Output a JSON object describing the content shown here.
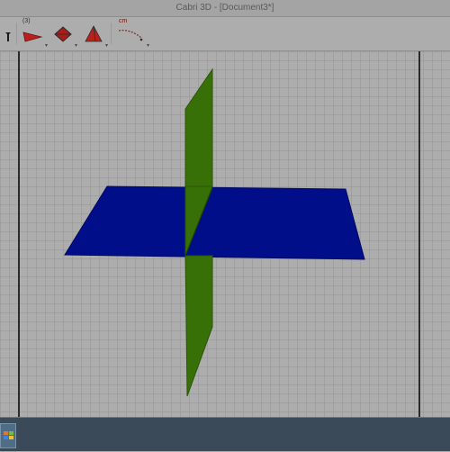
{
  "window": {
    "title": "Cabri 3D - [Document3*]"
  },
  "toolbar": {
    "tools": [
      {
        "name": "pointer-tool-icon"
      },
      {
        "name": "construct-plane-tool-icon",
        "badge": "(3)"
      },
      {
        "name": "polyhedron-tool-icon"
      },
      {
        "name": "pyramid-tool-icon"
      },
      {
        "name": "measure-tool-icon",
        "label": "cm"
      }
    ]
  },
  "scene": {
    "objects": [
      {
        "name": "horizontal-plane",
        "color": "#000e8a"
      },
      {
        "name": "vertical-plane",
        "color": "#387008"
      }
    ]
  },
  "colors": {
    "horizontal_plane": "#000e8a",
    "vertical_plane": "#387008",
    "tool_red": "#b8221c"
  }
}
